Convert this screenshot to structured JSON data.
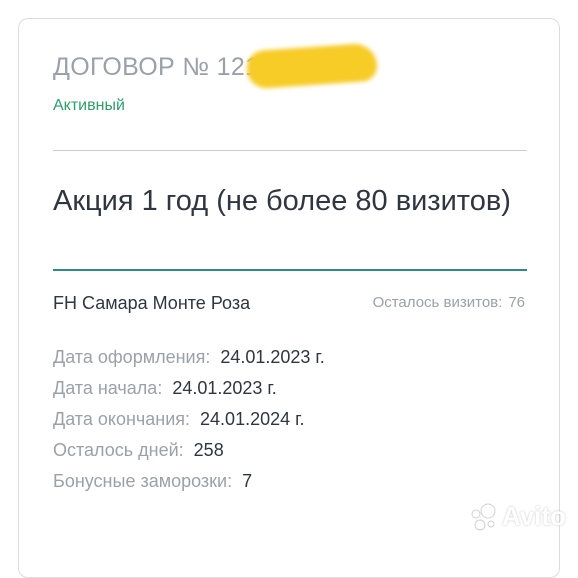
{
  "contract": {
    "title": "ДОГОВОР № 121/",
    "status": "Активный"
  },
  "plan": {
    "title": "Акция 1 год (не более 80 визитов)"
  },
  "club": {
    "name": "FH Самара Монте Роза",
    "visits_label": "Осталось визитов:",
    "visits_value": "76"
  },
  "details": [
    {
      "label": "Дата оформления:",
      "value": "24.01.2023 г."
    },
    {
      "label": "Дата начала:",
      "value": "24.01.2023 г."
    },
    {
      "label": "Дата окончания:",
      "value": "24.01.2024 г."
    },
    {
      "label": "Осталось дней:",
      "value": "258"
    },
    {
      "label": "Бонусные заморозки:",
      "value": "7"
    }
  ],
  "watermark": {
    "text": "Avito",
    "icon": "avito-logo-icon"
  },
  "colors": {
    "status_green": "#2e9e6b",
    "accent_teal": "#2f8c7c",
    "muted_gray": "#9aa1a8",
    "text_dark": "#2f3640",
    "redaction_yellow": "#f7cc27"
  }
}
